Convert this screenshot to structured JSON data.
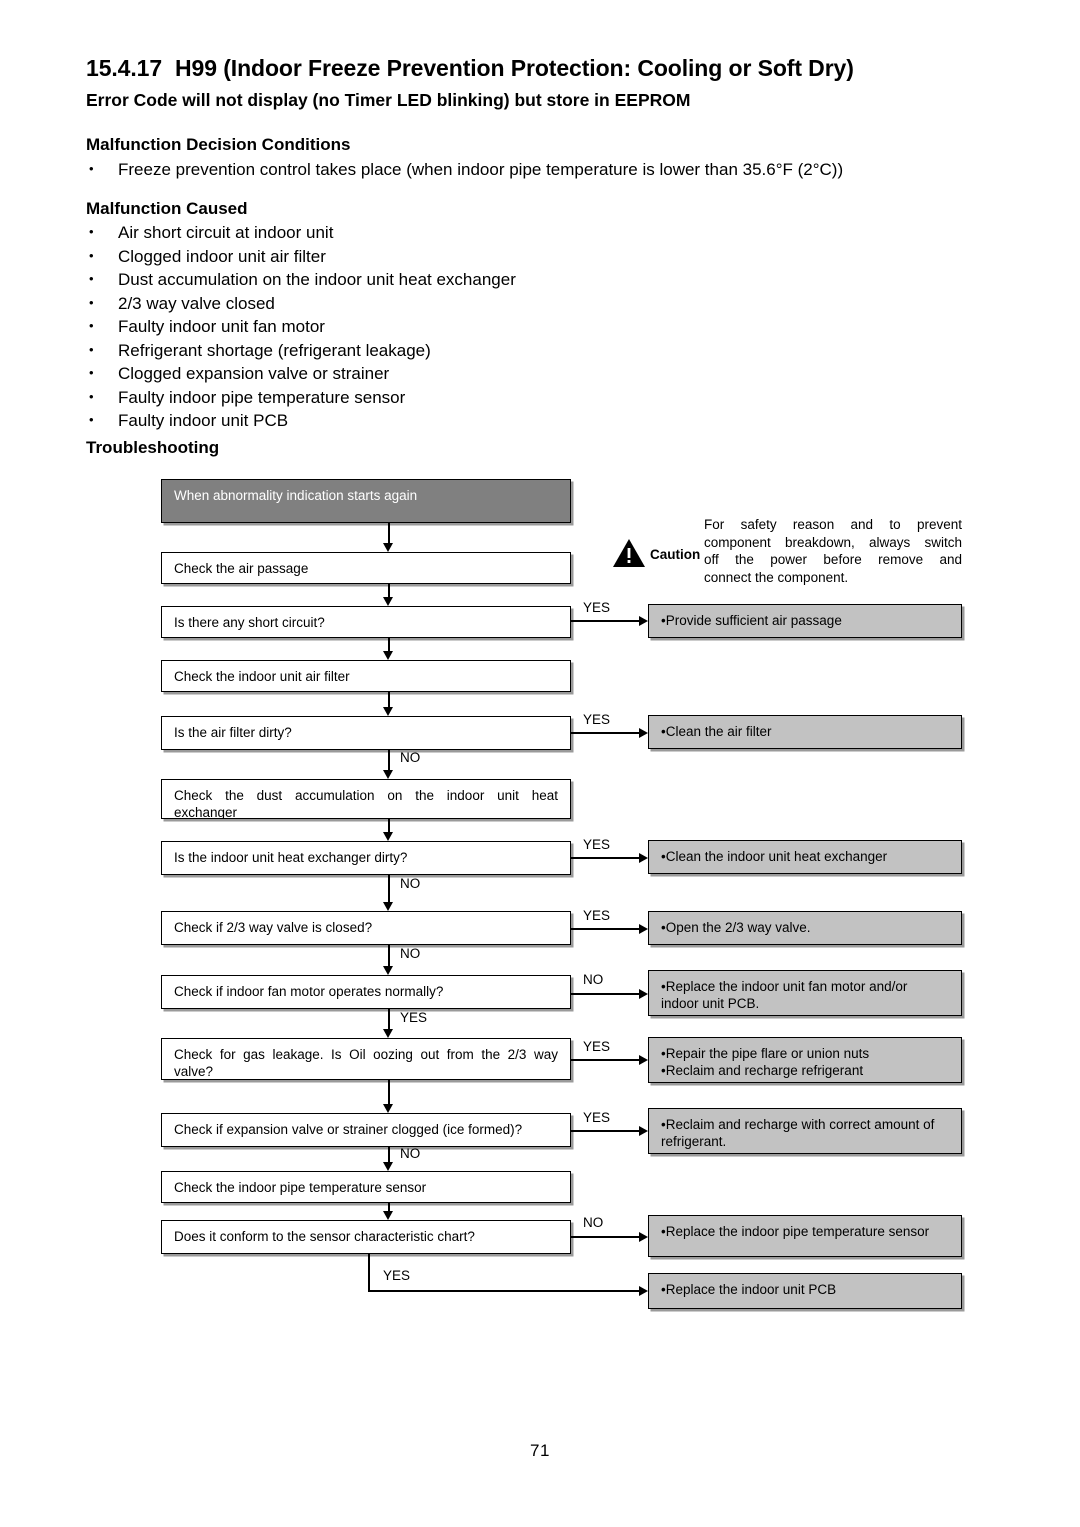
{
  "document": {
    "section_number": "15.4.17",
    "title": "H99 (Indoor Freeze Prevention Protection: Cooling or Soft Dry)",
    "subtitle": "Error Code will not display (no Timer LED blinking) but store in EEPROM",
    "page_number": "71"
  },
  "sections": {
    "decision_conditions": {
      "heading": "Malfunction Decision Conditions",
      "items": [
        "Freeze prevention control takes place (when indoor pipe temperature is lower than 35.6°F (2°C))"
      ]
    },
    "malfunction_caused": {
      "heading": "Malfunction Caused",
      "items": [
        "Air short circuit at indoor unit",
        "Clogged indoor unit air filter",
        "Dust accumulation on the indoor unit heat exchanger",
        "2/3 way valve closed",
        "Faulty indoor unit fan motor",
        "Refrigerant shortage (refrigerant leakage)",
        "Clogged expansion valve or strainer",
        "Faulty indoor pipe temperature sensor",
        "Faulty indoor unit PCB"
      ]
    },
    "troubleshooting": {
      "heading": "Troubleshooting"
    }
  },
  "caution": {
    "label": "Caution",
    "icon": "warning-triangle-icon",
    "line1": "For safety reason and to prevent",
    "line2": "component breakdown, always switch",
    "line3": "off the power before remove and",
    "line4": "connect the component."
  },
  "flowchart": {
    "start": "When abnormality indication starts again",
    "steps": {
      "check_air_passage": "Check the air passage",
      "q_short_circuit": "Is there any short circuit?",
      "check_air_filter": "Check the indoor unit air filter",
      "q_filter_dirty": "Is the air filter dirty?",
      "check_dust_l1": "Check the dust accumulation on the indoor unit heat",
      "check_dust_l2": "exchanger",
      "q_heat_exchanger_dirty": "Is the indoor unit heat exchanger dirty?",
      "q_valve_closed": "Check if 2/3 way valve is closed?",
      "q_fan_motor": "Check if indoor fan motor operates normally?",
      "q_gas_leak_l1": "Check for gas leakage. Is Oil oozing out from the 2/3 way",
      "q_gas_leak_l2": "valve?",
      "q_expansion_valve": "Check if expansion valve or strainer clogged (ice formed)?",
      "check_pipe_sensor": "Check the indoor pipe temperature sensor",
      "q_sensor_chart": "Does it conform to the sensor characteristic chart?"
    },
    "actions": {
      "air_passage": "•Provide sufficient air passage",
      "clean_filter": "•Clean the air filter",
      "clean_heat_exchanger": "•Clean the indoor unit heat exchanger",
      "open_valve": "•Open the 2/3 way valve.",
      "replace_fan_motor_l1": "•Replace the indoor unit fan motor and/or",
      "replace_fan_motor_l2": "indoor unit PCB.",
      "repair_pipe_l1": "•Repair the pipe flare or union nuts",
      "repair_pipe_l2": "•Reclaim and recharge refrigerant",
      "recharge_l1": "•Reclaim and recharge with correct amount of",
      "recharge_l2": "refrigerant.",
      "replace_sensor": "•Replace the indoor pipe temperature sensor",
      "replace_pcb": "•Replace the indoor unit PCB"
    },
    "labels": {
      "yes_short_circuit": "YES",
      "yes_filter_dirty": "YES",
      "no_filter_dirty": "NO",
      "yes_heat_exchanger": "YES",
      "no_heat_exchanger": "NO",
      "yes_valve": "YES",
      "no_valve": "NO",
      "no_fan_motor": "NO",
      "yes_fan_motor": "YES",
      "yes_gas_leak": "YES",
      "yes_expansion": "YES",
      "no_expansion": "NO",
      "no_sensor_chart": "NO",
      "yes_sensor_chart": "YES"
    }
  },
  "colors": {
    "start_box_fill": "#808080",
    "action_box_fill": "#c2c2c2",
    "line": "#000000"
  }
}
